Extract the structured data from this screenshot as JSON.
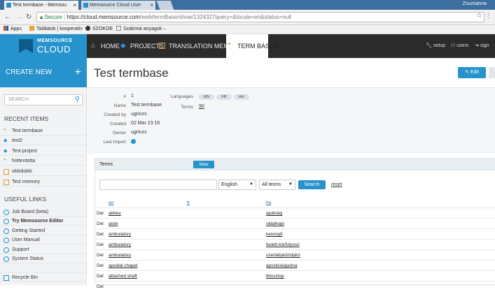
{
  "browser": {
    "tabs": [
      {
        "label": "Test termbase - Memsou"
      },
      {
        "label": "Memsource Cloud User"
      }
    ],
    "user": "Zsuzsanna",
    "secure_label": "Secure",
    "url_main": "https://cloud.memsource.com",
    "url_rest": "/web/termBase/show/1324327query=&locale=en&status=null",
    "bookmarks": [
      {
        "label": "Apps"
      },
      {
        "label": "Találatok | kooperatív"
      },
      {
        "label": "SZOKOE"
      },
      {
        "label": "Szakmai anyagok –"
      }
    ]
  },
  "app": {
    "logo_top": "MEMSOURCE",
    "logo_bottom": "CLOUD",
    "nav": [
      {
        "label": "HOME",
        "icon": "home-icon"
      },
      {
        "label": "PROJECTS",
        "icon": "projects-icon"
      },
      {
        "label": "TRANSLATION MEMORIES",
        "icon": "tm-icon"
      },
      {
        "label": "TERM BASES",
        "icon": "termbase-icon"
      }
    ],
    "setup": "setup",
    "users": "users",
    "sign": "sign"
  },
  "sidebar": {
    "create_new": "CREATE NEW",
    "search_placeholder": "SEARCH",
    "recent_title": "RECENT ITEMS",
    "recent": [
      {
        "label": "Test termbase",
        "type": "termbase"
      },
      {
        "label": "test2",
        "type": "project"
      },
      {
        "label": "Test project",
        "type": "project"
      },
      {
        "label": "hottentotta",
        "type": "termbase"
      },
      {
        "label": "okkidokki",
        "type": "memory"
      },
      {
        "label": "Test memory",
        "type": "memory"
      }
    ],
    "links_title": "USEFUL LINKS",
    "links": [
      {
        "label": "Job Board (beta)"
      },
      {
        "label": "Try Memsource Editor"
      },
      {
        "label": "Getting Started"
      },
      {
        "label": "User Manual"
      },
      {
        "label": "Support"
      },
      {
        "label": "System Status"
      }
    ],
    "recycle": "Recycle Bin"
  },
  "page": {
    "title": "Test termbase",
    "edit": "Edit",
    "info": {
      "id_label": "#",
      "id": "1",
      "name_label": "Name",
      "name": "Test termbase",
      "created_by_label": "Created by",
      "created_by": "ugrinzs",
      "created_label": "Created",
      "created": "02 Mar 23:16",
      "owner_label": "Owner",
      "owner": "ugrinzs",
      "last_import_label": "Last Import",
      "languages_label": "Languages",
      "languages": [
        "EN",
        "FR",
        "HU"
      ],
      "terms_label": "Terms",
      "terms": "90"
    },
    "terms": {
      "title": "Terms",
      "new": "New",
      "lang_select": "English",
      "filter_select": "All terms",
      "search": "Search",
      "reset": "reset",
      "columns": [
        "en",
        "fr",
        "hu"
      ],
      "rows": [
        {
          "del": "Del",
          "en": "abbey",
          "hu": "apátság"
        },
        {
          "del": "Del",
          "en": "aisle",
          "hu": "oldalhajó"
        },
        {
          "del": "Del",
          "en": "ambulatory",
          "hu": "kerengő"
        },
        {
          "del": "Del",
          "en": "ambulatory",
          "hu": "fedett körfolyosó"
        },
        {
          "del": "Del",
          "en": "ambulatory",
          "hu": "szentélykörüljáró"
        },
        {
          "del": "Del",
          "en": "apsidal chapel",
          "hu": "apszkiskápolna"
        },
        {
          "del": "Del",
          "en": "attached shaft",
          "hu": "féloszlop"
        },
        {
          "del": "Del",
          "en": "",
          "hu": ""
        }
      ]
    }
  }
}
